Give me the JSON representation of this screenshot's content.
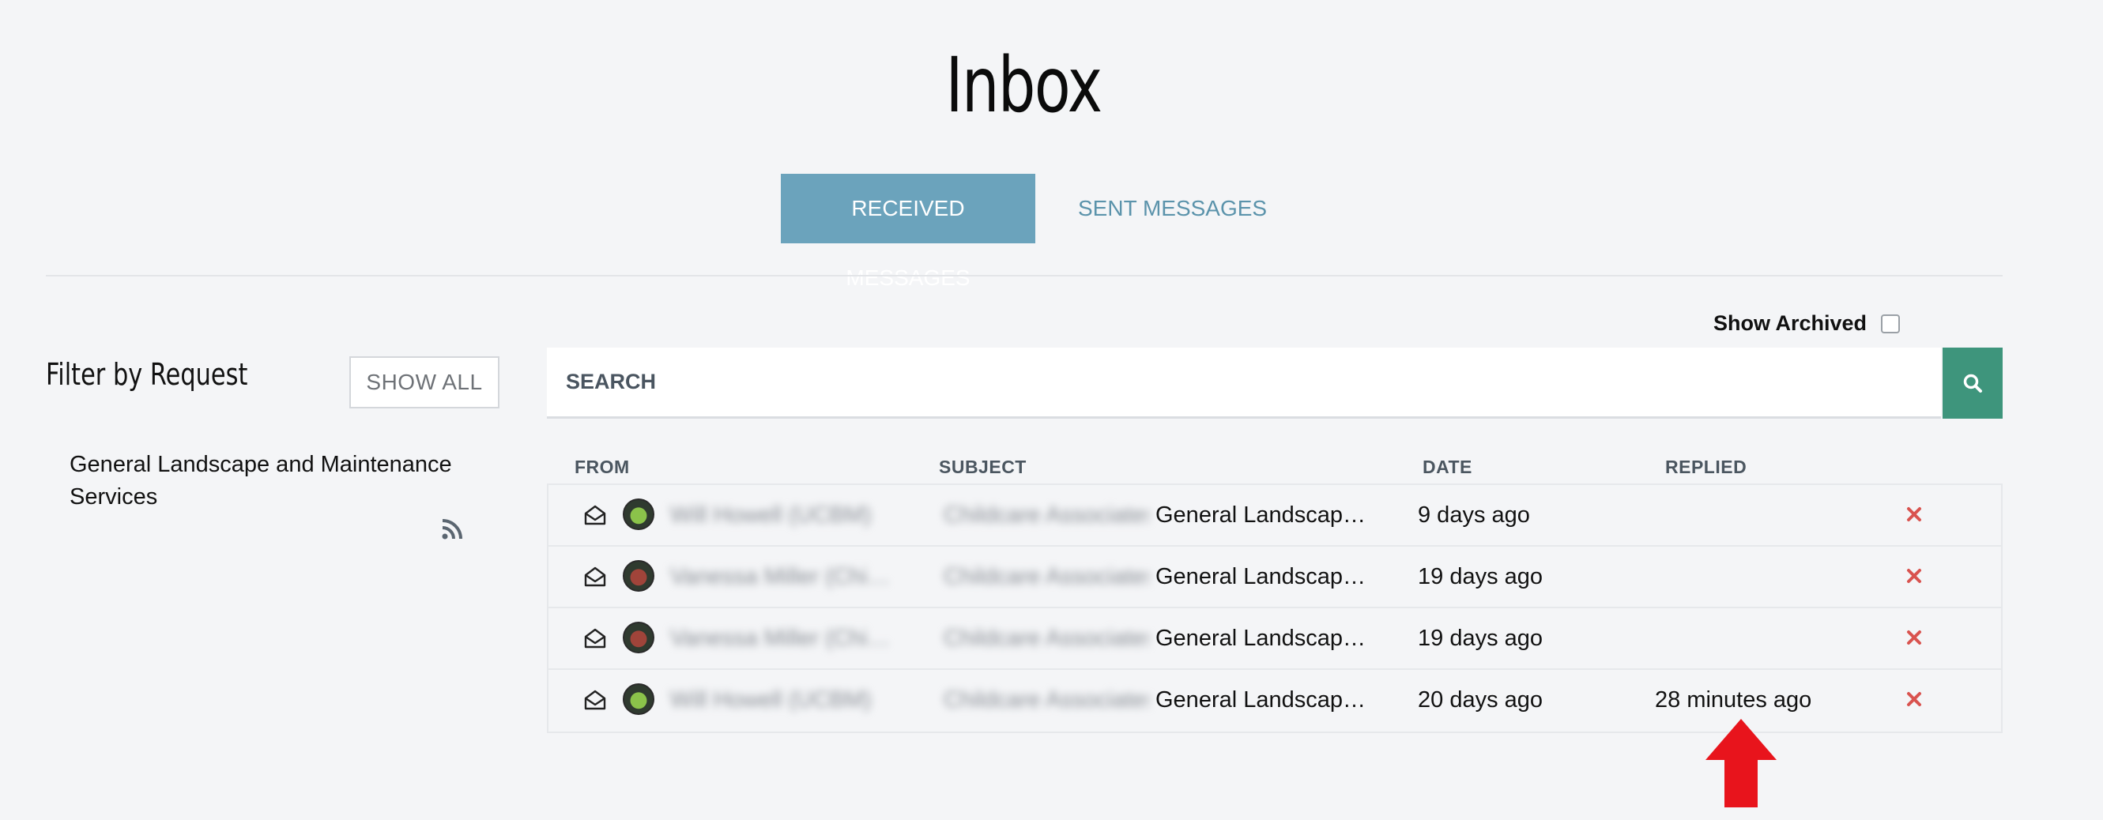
{
  "page": {
    "title": "Inbox"
  },
  "tabs": {
    "received": "RECEIVED MESSAGES",
    "sent": "SENT MESSAGES"
  },
  "archived": {
    "label": "Show Archived",
    "checked": false
  },
  "filter": {
    "title": "Filter by Request",
    "show_all": "SHOW ALL",
    "requests": [
      "General Landscape and Maintenance Services"
    ]
  },
  "search": {
    "placeholder": "SEARCH"
  },
  "table": {
    "headers": {
      "from": "FROM",
      "subject": "SUBJECT",
      "date": "DATE",
      "replied": "REPLIED"
    },
    "rows": [
      {
        "from": "Will Howell (UCBM)",
        "subject_prefix": "Childcare Associates",
        "subject": "General Landscap…",
        "date": "9 days ago",
        "replied": "",
        "avatar_color": "#8bc34a"
      },
      {
        "from": "Vanessa Miller (Chi…",
        "subject_prefix": "Childcare Associates",
        "subject": "General Landscap…",
        "date": "19 days ago",
        "replied": "",
        "avatar_color": "#a0443a"
      },
      {
        "from": "Vanessa Miller (Chi…",
        "subject_prefix": "Childcare Associates",
        "subject": "General Landscap…",
        "date": "19 days ago",
        "replied": "",
        "avatar_color": "#a0443a"
      },
      {
        "from": "Will Howell (UCBM)",
        "subject_prefix": "Childcare Associates",
        "subject": "General Landscap…",
        "date": "20 days ago",
        "replied": "28 minutes ago",
        "avatar_color": "#8bc34a"
      }
    ]
  },
  "colors": {
    "accent": "#6ba3bc",
    "search_button": "#3e957c",
    "delete": "#d9534f",
    "annotation_arrow": "#e8141c"
  }
}
